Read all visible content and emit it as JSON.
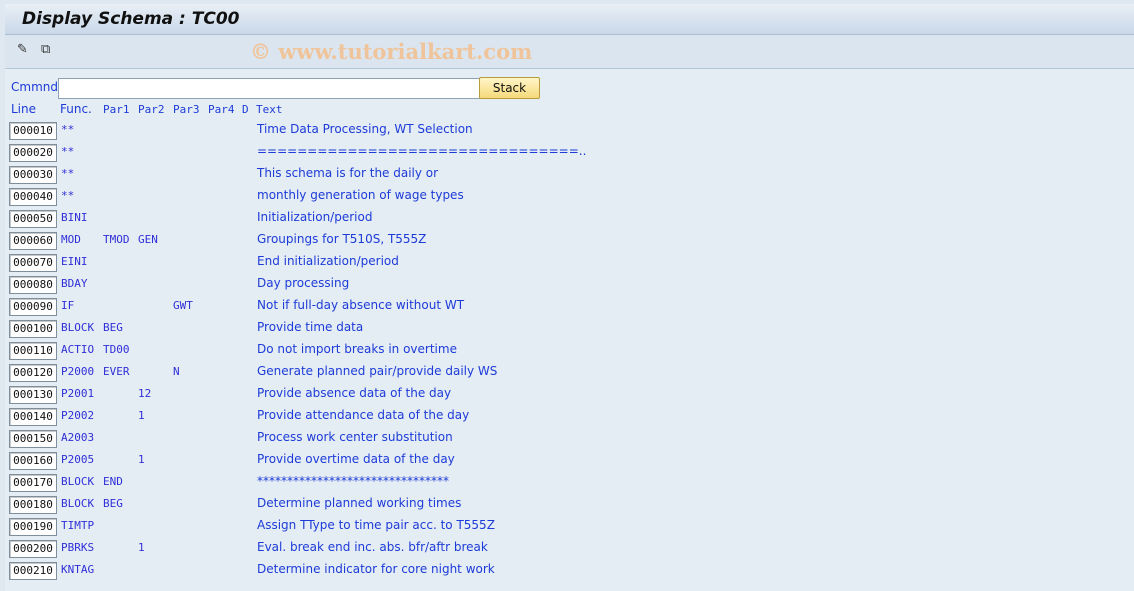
{
  "window": {
    "title": "Display Schema : TC00"
  },
  "toolbar": {
    "icons": [
      "display-change-icon",
      "other-object-icon"
    ],
    "watermark": "© www.tutorialkart.com"
  },
  "command": {
    "label": "Cmmnd",
    "value": "",
    "stack_label": "Stack"
  },
  "columns": {
    "line": "Line",
    "func": "Func.",
    "par1": "Par1",
    "par2": "Par2",
    "par3": "Par3",
    "par4": "Par4",
    "d": "D",
    "text": "Text"
  },
  "rows": [
    {
      "line": "000010",
      "func": "**",
      "par1": "",
      "par2": "",
      "par3": "",
      "par4": "",
      "d": "",
      "text": "Time Data Processing, WT Selection"
    },
    {
      "line": "000020",
      "func": "**",
      "par1": "",
      "par2": "",
      "par3": "",
      "par4": "",
      "d": "",
      "text": "================================.."
    },
    {
      "line": "000030",
      "func": "**",
      "par1": "",
      "par2": "",
      "par3": "",
      "par4": "",
      "d": "",
      "text": "This schema is for the daily or"
    },
    {
      "line": "000040",
      "func": "**",
      "par1": "",
      "par2": "",
      "par3": "",
      "par4": "",
      "d": "",
      "text": "monthly generation of wage types"
    },
    {
      "line": "000050",
      "func": "BINI",
      "par1": "",
      "par2": "",
      "par3": "",
      "par4": "",
      "d": "",
      "text": "Initialization/period"
    },
    {
      "line": "000060",
      "func": "MOD",
      "par1": "TMOD",
      "par2": "GEN",
      "par3": "",
      "par4": "",
      "d": "",
      "text": "Groupings for T510S, T555Z"
    },
    {
      "line": "000070",
      "func": "EINI",
      "par1": "",
      "par2": "",
      "par3": "",
      "par4": "",
      "d": "",
      "text": "End initialization/period"
    },
    {
      "line": "000080",
      "func": "BDAY",
      "par1": "",
      "par2": "",
      "par3": "",
      "par4": "",
      "d": "",
      "text": "Day processing"
    },
    {
      "line": "000090",
      "func": "IF",
      "par1": "",
      "par2": "",
      "par3": "GWT",
      "par4": "",
      "d": "",
      "text": "Not if full-day absence without WT"
    },
    {
      "line": "000100",
      "func": "BLOCK",
      "par1": "BEG",
      "par2": "",
      "par3": "",
      "par4": "",
      "d": "",
      "text": "Provide time data"
    },
    {
      "line": "000110",
      "func": "ACTIO",
      "par1": "TD00",
      "par2": "",
      "par3": "",
      "par4": "",
      "d": "",
      "text": "Do not import breaks in overtime"
    },
    {
      "line": "000120",
      "func": "P2000",
      "par1": "EVER",
      "par2": "",
      "par3": "N",
      "par4": "",
      "d": "",
      "text": "Generate planned pair/provide daily WS"
    },
    {
      "line": "000130",
      "func": "P2001",
      "par1": "",
      "par2": "12",
      "par3": "",
      "par4": "",
      "d": "",
      "text": "Provide absence data of the day"
    },
    {
      "line": "000140",
      "func": "P2002",
      "par1": "",
      "par2": "1",
      "par3": "",
      "par4": "",
      "d": "",
      "text": "Provide attendance data of the day"
    },
    {
      "line": "000150",
      "func": "A2003",
      "par1": "",
      "par2": "",
      "par3": "",
      "par4": "",
      "d": "",
      "text": "Process work center substitution"
    },
    {
      "line": "000160",
      "func": "P2005",
      "par1": "",
      "par2": "1",
      "par3": "",
      "par4": "",
      "d": "",
      "text": "Provide overtime data of the day"
    },
    {
      "line": "000170",
      "func": "BLOCK",
      "par1": "END",
      "par2": "",
      "par3": "",
      "par4": "",
      "d": "",
      "text": "********************************"
    },
    {
      "line": "000180",
      "func": "BLOCK",
      "par1": "BEG",
      "par2": "",
      "par3": "",
      "par4": "",
      "d": "",
      "text": "Determine planned working times"
    },
    {
      "line": "000190",
      "func": "TIMTP",
      "par1": "",
      "par2": "",
      "par3": "",
      "par4": "",
      "d": "",
      "text": "Assign TType to time pair acc. to T555Z"
    },
    {
      "line": "000200",
      "func": "PBRKS",
      "par1": "",
      "par2": "1",
      "par3": "",
      "par4": "",
      "d": "",
      "text": "Eval. break end inc. abs. bfr/aftr break"
    },
    {
      "line": "000210",
      "func": "KNTAG",
      "par1": "",
      "par2": "",
      "par3": "",
      "par4": "",
      "d": "",
      "text": "Determine indicator for core night work"
    }
  ]
}
